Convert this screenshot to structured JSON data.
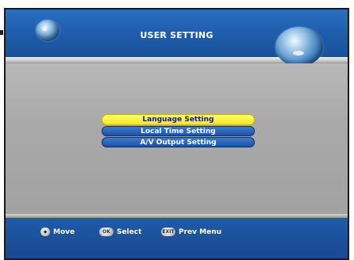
{
  "header": {
    "title": "USER SETTING"
  },
  "menu": {
    "items": [
      {
        "label": "Language Setting",
        "selected": true
      },
      {
        "label": "Local Time Setting",
        "selected": false
      },
      {
        "label": "A/V Output Setting",
        "selected": false
      }
    ]
  },
  "footer": {
    "move_label": "Move",
    "select_label": "Select",
    "prev_label": "Prev Menu"
  },
  "colors": {
    "header_blue": "#1e5aa8",
    "panel_grey": "#a9a9a9",
    "highlight_yellow": "#f2ec1a",
    "item_blue": "#1e52a2"
  },
  "icons": {
    "move": "dpad-icon",
    "select": "ok-key-icon",
    "prev": "exit-key-icon"
  }
}
